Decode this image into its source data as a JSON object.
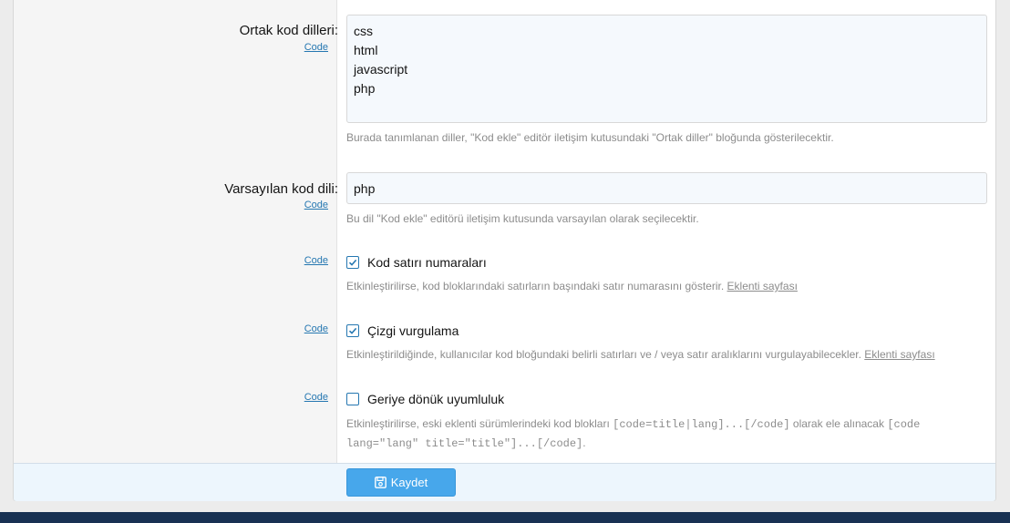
{
  "form": {
    "languages": {
      "label": "Ortak kod dilleri:",
      "code_link": "Code",
      "value": "css\nhtml\njavascript\nphp",
      "hint": "Burada tanımlanan diller, \"Kod ekle\" editör iletişim kutusundaki \"Ortak diller\" bloğunda gösterilecektir."
    },
    "default_language": {
      "label": "Varsayılan kod dili:",
      "code_link": "Code",
      "value": "php",
      "hint": "Bu dil \"Kod ekle\" editörü iletişim kutusunda varsayılan olarak seçilecektir."
    },
    "line_numbers": {
      "code_link": "Code",
      "label": "Kod satırı numaraları",
      "checked": true,
      "hint": "Etkinleştirilirse, kod bloklarındaki satırların başındaki satır numarasını gösterir.",
      "hint_link": "Eklenti sayfası"
    },
    "line_highlight": {
      "code_link": "Code",
      "label": "Çizgi vurgulama",
      "checked": true,
      "hint": "Etkinleştirildiğinde, kullanıcılar kod bloğundaki belirli satırları ve / veya satır aralıklarını vurgulayabilecekler.",
      "hint_link": "Eklenti sayfası"
    },
    "backwards_compat": {
      "code_link": "Code",
      "label": "Geriye dönük uyumluluk",
      "checked": false,
      "hint_before": "Etkinleştirilirse, eski eklenti sürümlerindeki kod blokları",
      "hint_code1": "[code=title|lang]...[/code]",
      "hint_middle": "olarak ele alınacak",
      "hint_code2": "[code lang=\"lang\" title=\"title\"]...[/code]",
      "hint_end": "."
    }
  },
  "footer": {
    "save_label": "Kaydet",
    "save_icon": "floppy-disk-icon"
  },
  "colors": {
    "accent": "#47a7eb",
    "link": "#2577b1",
    "bottom_bar": "#183153"
  }
}
